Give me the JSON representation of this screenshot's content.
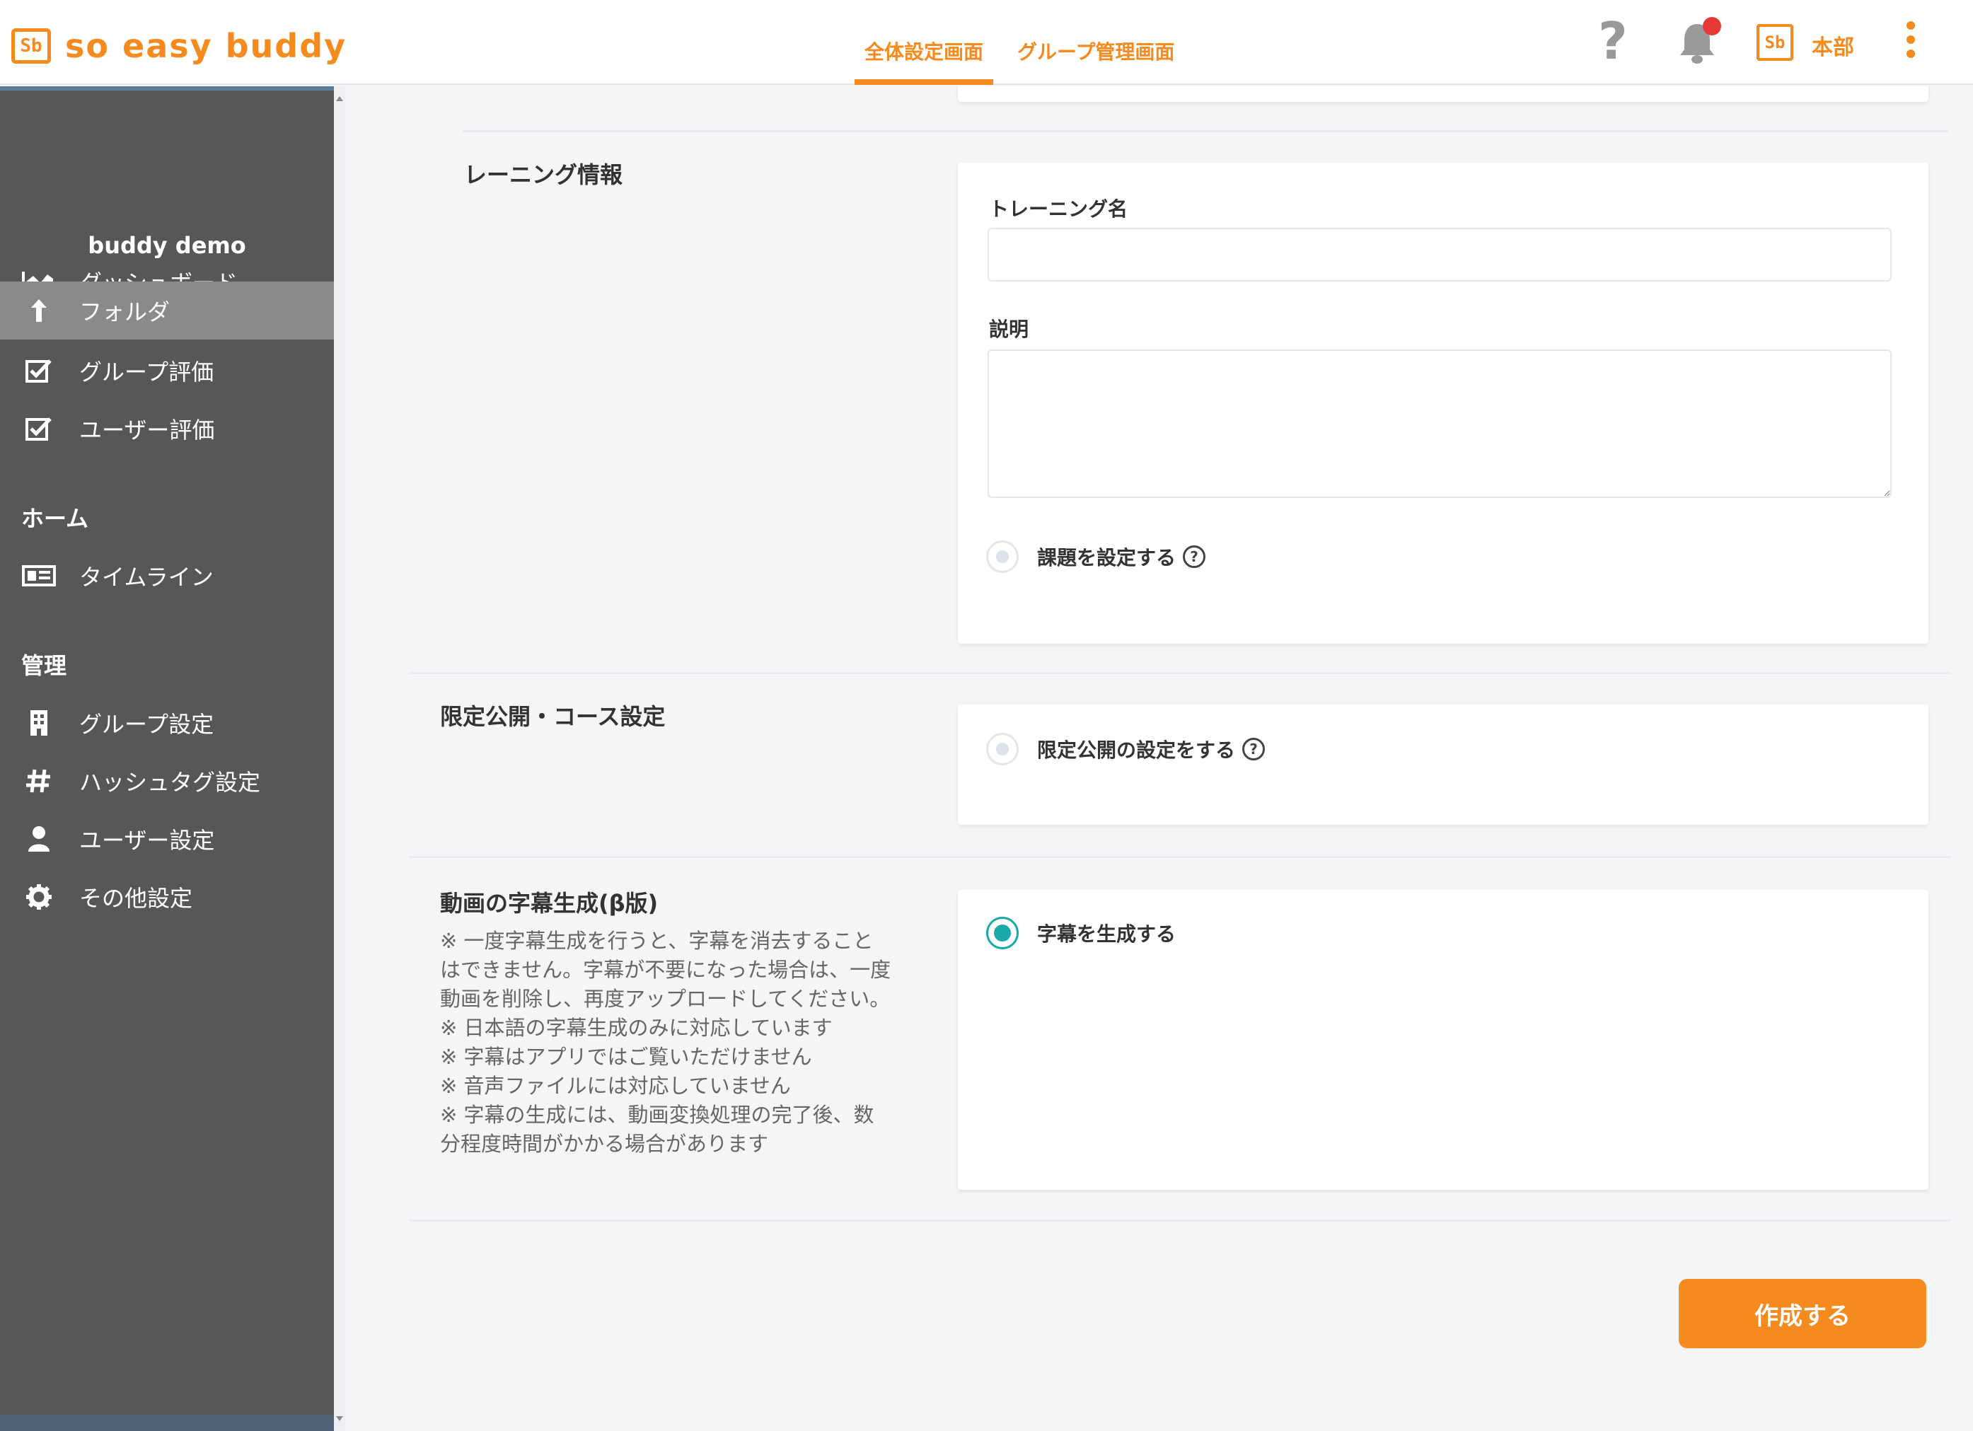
{
  "header": {
    "logo_mark": "Sb",
    "logo_text": "so easy buddy",
    "tabs": [
      {
        "label": "全体設定画面",
        "active": true
      },
      {
        "label": "グループ管理画面",
        "active": false
      }
    ],
    "help_glyph": "?",
    "org_mark": "Sb",
    "org_name": "本部"
  },
  "sidebar": {
    "org_title": "buddy demo",
    "items": [
      {
        "label": "ダッシュボード",
        "icon": "chart-icon",
        "active": false
      },
      {
        "label": "フォルダ",
        "icon": "upload-icon",
        "active": true
      },
      {
        "label": "グループ評価",
        "icon": "checkbox-icon",
        "active": false
      },
      {
        "label": "ユーザー評価",
        "icon": "checkbox-icon",
        "active": false
      }
    ],
    "section_home": "ホーム",
    "home_items": [
      {
        "label": "タイムライン",
        "icon": "timeline-icon"
      }
    ],
    "section_admin": "管理",
    "admin_items": [
      {
        "label": "グループ設定",
        "icon": "building-icon"
      },
      {
        "label": "ハッシュタグ設定",
        "icon": "hash-icon"
      },
      {
        "label": "ユーザー設定",
        "icon": "user-icon"
      },
      {
        "label": "その他設定",
        "icon": "gear-icon"
      }
    ]
  },
  "main": {
    "training_section_label": "レーニング情報",
    "training_name_label": "トレーニング名",
    "training_name_value": "",
    "description_label": "説明",
    "description_value": "",
    "assignment_radio_label": "課題を設定する",
    "limited_section_label": "限定公開・コース設定",
    "limited_radio_label": "限定公開の設定をする",
    "subtitle_section_label": "動画の字幕生成(β版)",
    "subtitle_notes": [
      "※ 一度字幕生成を行うと、字幕を消去することはできません。字幕が不要になった場合は、一度動画を削除し、再度アップロードしてください。",
      "※ 日本語の字幕生成のみに対応しています",
      "※ 字幕はアプリではご覧いただけません",
      "※ 音声ファイルには対応していません",
      "※ 字幕の生成には、動画変換処理の完了後、数分程度時間がかかる場合があります"
    ],
    "subtitle_radio_label": "字幕を生成する",
    "subtitle_radio_checked": true,
    "help_glyph": "?",
    "create_button": "作成する"
  },
  "colors": {
    "accent": "#f58a1f",
    "sidebar_bg": "#575757",
    "sidebar_active": "#8a8a8a",
    "radio_checked": "#1aa8a8",
    "notification": "#e53935"
  }
}
